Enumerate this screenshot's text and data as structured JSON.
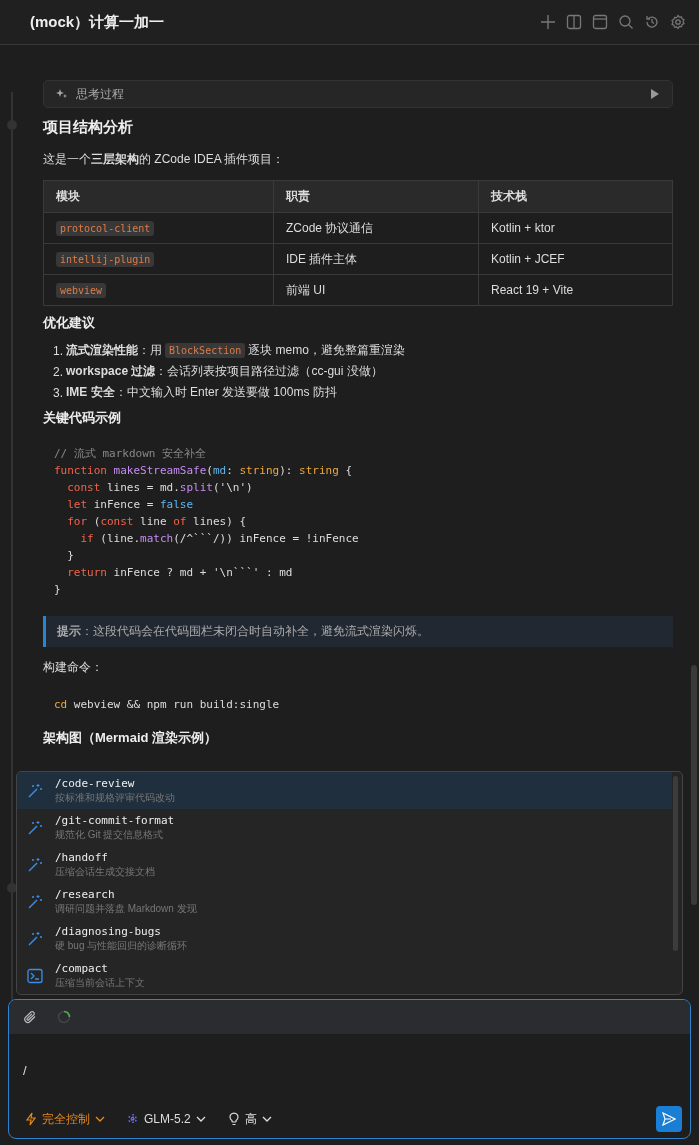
{
  "header": {
    "title": "(mock）计算一加一"
  },
  "thinking": {
    "label": "思考过程",
    "expanded": false
  },
  "heading_1": "项目结构分析",
  "intro": "这是一个**三层架构**的 ZCode IDEA 插件项目：",
  "table": {
    "columns": [
      "模块",
      "职责",
      "技术栈"
    ],
    "rows": [
      [
        "protocol-client",
        "ZCode 协议通信",
        "Kotlin + ktor"
      ],
      [
        "intellij-plugin",
        "IDE 插件主体",
        "Kotlin + JCEF"
      ],
      [
        "webview",
        "前端 UI",
        "React 19 + Vite"
      ]
    ]
  },
  "heading_2": "优化建议",
  "suggestions": [
    {
      "number": "1.",
      "segments": [
        {
          "kind": "text",
          "text": "**流式渲染性能**：用 "
        },
        {
          "kind": "code",
          "text": "BlockSection"
        },
        {
          "kind": "text",
          "text": " 逐块 memo，避免整篇重渲染"
        }
      ]
    },
    {
      "number": "2.",
      "segments": [
        {
          "kind": "text",
          "text": "**workspace 过滤**：会话列表按项目路径过滤（cc-gui 没做）"
        }
      ]
    },
    {
      "number": "3.",
      "segments": [
        {
          "kind": "text",
          "text": "**IME 安全**：中文输入时 Enter 发送要做 100ms 防抖"
        }
      ]
    }
  ],
  "heading_3": "关键代码示例",
  "code": [
    [
      {
        "kind": "comment",
        "text": "// 流式 markdown 安全补全"
      }
    ],
    [
      {
        "kind": "keyword",
        "text": "function"
      },
      {
        "kind": "function",
        "text": " makeStreamSafe"
      },
      {
        "kind": "plain",
        "text": "("
      },
      {
        "kind": "param",
        "text": "md"
      },
      {
        "kind": "plain",
        "text": ": "
      },
      {
        "kind": "type",
        "text": "string"
      },
      {
        "kind": "plain",
        "text": "): "
      },
      {
        "kind": "type",
        "text": "string"
      },
      {
        "kind": "plain",
        "text": " {"
      }
    ],
    [
      {
        "kind": "keyword",
        "text": "  const"
      },
      {
        "kind": "plain",
        "text": " lines = md."
      },
      {
        "kind": "function",
        "text": "split"
      },
      {
        "kind": "plain",
        "text": "('\\n')"
      }
    ],
    [
      {
        "kind": "keyword",
        "text": "  let"
      },
      {
        "kind": "plain",
        "text": " inFence = "
      },
      {
        "kind": "literal",
        "text": "false"
      }
    ],
    [
      {
        "kind": "keyword",
        "text": "  for"
      },
      {
        "kind": "plain",
        "text": " ("
      },
      {
        "kind": "keyword",
        "text": "const"
      },
      {
        "kind": "plain",
        "text": " line "
      },
      {
        "kind": "keyword",
        "text": "of"
      },
      {
        "kind": "plain",
        "text": " lines) {"
      }
    ],
    [
      {
        "kind": "keyword",
        "text": "    if"
      },
      {
        "kind": "plain",
        "text": " (line."
      },
      {
        "kind": "function",
        "text": "match"
      },
      {
        "kind": "plain",
        "text": "(/^```/)) inFence = !inFence"
      }
    ],
    [
      {
        "kind": "plain",
        "text": "  }"
      }
    ],
    [
      {
        "kind": "keyword",
        "text": "  return"
      },
      {
        "kind": "plain",
        "text": " inFence ? md + '\\n```' : md"
      }
    ],
    [
      {
        "kind": "plain",
        "text": "}"
      }
    ]
  ],
  "tip": "**提示**：这段代码会在代码围栏未闭合时自动补全，避免流式渲染闪烁。",
  "build_label": "构建命令：",
  "command": [
    {
      "kind": "type",
      "text": "cd"
    },
    {
      "kind": "plain",
      "text": " webview && npm run build:single"
    }
  ],
  "heading_4": "架构图（Mermaid 渲染示例）",
  "slash_menu": [
    {
      "kind": "skill",
      "command": "/code-review",
      "description": "按标准和规格评审代码改动",
      "selected": true
    },
    {
      "kind": "skill",
      "command": "/git-commit-format",
      "description": "规范化 Git 提交信息格式",
      "selected": false
    },
    {
      "kind": "skill",
      "command": "/handoff",
      "description": "压缩会话生成交接文档",
      "selected": false
    },
    {
      "kind": "skill",
      "command": "/research",
      "description": "调研问题并落盘 Markdown 发现",
      "selected": false
    },
    {
      "kind": "skill",
      "command": "/diagnosing-bugs",
      "description": "硬 bug 与性能回归的诊断循环",
      "selected": false
    },
    {
      "kind": "terminal",
      "command": "/compact",
      "description": "压缩当前会话上下文",
      "selected": false
    }
  ],
  "composer": {
    "value": "/",
    "mode": "完全控制",
    "model": "GLM-5.2",
    "effort": "高"
  }
}
